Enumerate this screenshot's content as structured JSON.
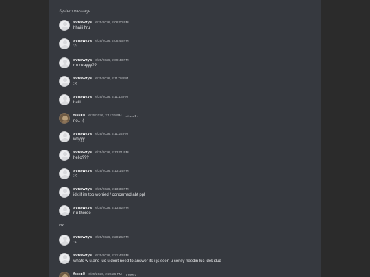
{
  "system_message": "System message",
  "divider_note": "idk",
  "messages": [
    {
      "username": "svnswzys",
      "timestamp": "6/25/2026, 2:08:00 PM",
      "content": "hhaiii hru",
      "avatar": "default-avatar",
      "tag": ""
    },
    {
      "username": "svnswzys",
      "timestamp": "6/25/2026, 2:08:46 PM",
      "content": ":c",
      "avatar": "default-avatar",
      "tag": ""
    },
    {
      "username": "svnswzys",
      "timestamp": "6/25/2026, 2:09:43 PM",
      "content": "r u okayyy??",
      "avatar": "default-avatar",
      "tag": ""
    },
    {
      "username": "svnswzys",
      "timestamp": "6/25/2026, 2:11:08 PM",
      "content": ":<",
      "avatar": "default-avatar",
      "tag": ""
    },
    {
      "username": "svnswzys",
      "timestamp": "6/25/2026, 2:11:13 PM",
      "content": "haiii",
      "avatar": "default-avatar",
      "tag": ""
    },
    {
      "username": "fᴇᴇᴇᴇ𝟶",
      "timestamp": "6/25/2026, 2:11:16 PM",
      "content": "no.. :(",
      "avatar": "cat-avatar",
      "tag": "• fᴇᴇᴇᴇ𝟶 •"
    },
    {
      "username": "svnswzys",
      "timestamp": "6/25/2026, 2:11:22 PM",
      "content": "whyyy",
      "avatar": "default-avatar",
      "tag": ""
    },
    {
      "username": "svnswzys",
      "timestamp": "6/25/2026, 2:13:01 PM",
      "content": "hello???",
      "avatar": "default-avatar",
      "tag": ""
    },
    {
      "username": "svnswzys",
      "timestamp": "6/25/2026, 2:13:14 PM",
      "content": ":<",
      "avatar": "default-avatar",
      "tag": ""
    },
    {
      "username": "svnswzys",
      "timestamp": "6/25/2026, 2:13:38 PM",
      "content": "idk if im too worried / concerned abt ppl",
      "avatar": "default-avatar",
      "tag": ""
    },
    {
      "username": "svnswzys",
      "timestamp": "6/25/2026, 2:13:52 PM",
      "content": "r u theree",
      "avatar": "default-avatar",
      "tag": ""
    },
    {
      "username": "svnswzys",
      "timestamp": "6/25/2026, 2:20:25 PM",
      "content": ":<",
      "avatar": "default-avatar",
      "tag": ""
    },
    {
      "username": "svnswzys",
      "timestamp": "6/25/2026, 2:21:43 PM",
      "content": "whats w u and luc u dont need to answer its i js seen u consy needin luc idek dud",
      "avatar": "default-avatar",
      "tag": ""
    },
    {
      "username": "fᴇᴇᴇᴇ𝟶",
      "timestamp": "6/25/2026, 2:26:26 PM",
      "content": "",
      "avatar": "cat-avatar",
      "tag": "• fᴇᴇᴇᴇ𝟶 •"
    }
  ]
}
